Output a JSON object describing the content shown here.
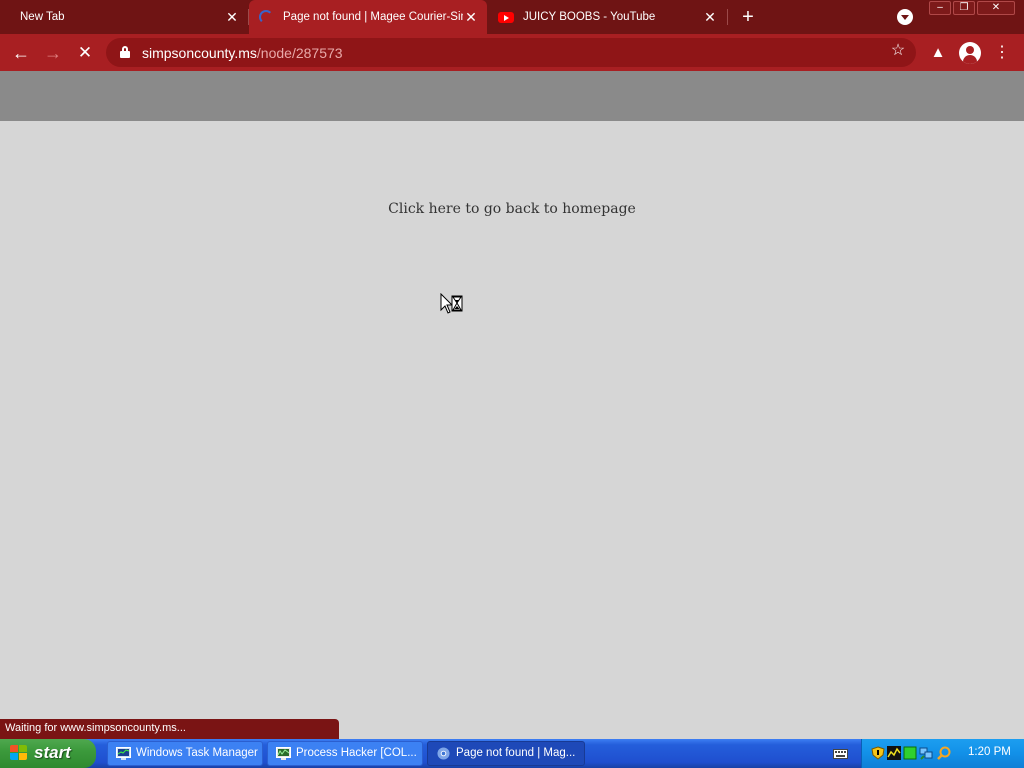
{
  "browser": {
    "tabs": [
      {
        "title": "New Tab"
      },
      {
        "title": "Page not found | Magee Courier-Simpson County News"
      },
      {
        "title": "JUICY BOOBS - YouTube"
      }
    ],
    "url_host": "simpsoncounty.ms",
    "url_path": "/node/287573",
    "status_text": "Waiting for www.simpsoncounty.ms..."
  },
  "page": {
    "home_link": "Click here to go back to homepage"
  },
  "taskbar": {
    "start_label": "start",
    "tasks": [
      {
        "label": "Windows Task Manager"
      },
      {
        "label": "Process Hacker [COL..."
      },
      {
        "label": "Page not found | Mag..."
      }
    ],
    "clock": "1:20 PM"
  },
  "colors": {
    "tabstrip": "#6f1414",
    "active_tab": "#a81f22",
    "page_background": "#d6d6d6",
    "header_band": "#8a8a8a"
  },
  "icons": {
    "tab_2": "loading-spinner-icon",
    "tab_3": "youtube-icon"
  }
}
